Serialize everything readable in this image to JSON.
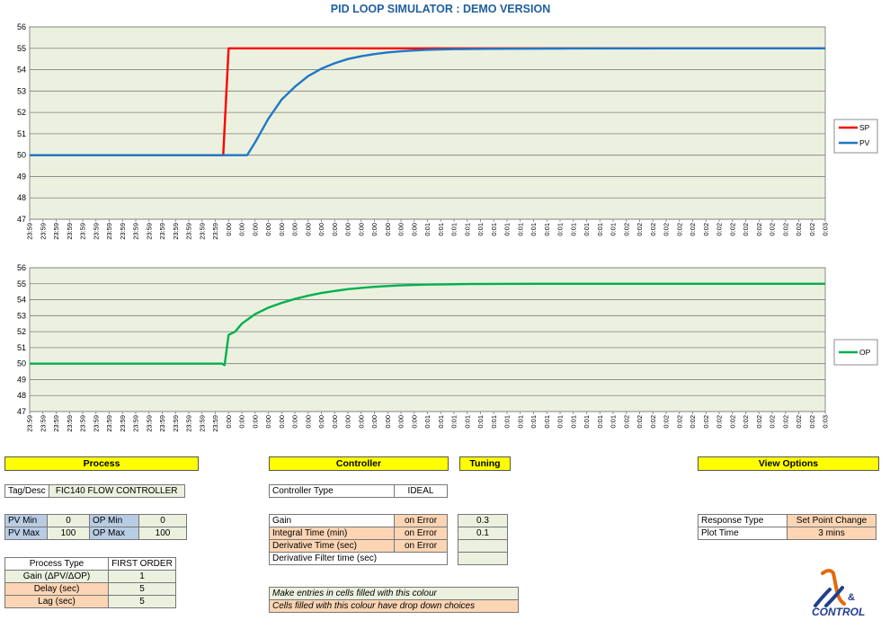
{
  "title": "PID LOOP SIMULATOR : DEMO VERSION",
  "chart_data": [
    {
      "type": "line",
      "ylim": [
        47,
        56
      ],
      "yticks": [
        47,
        48,
        49,
        50,
        51,
        52,
        53,
        54,
        55,
        56
      ],
      "x_labels": [
        "23:59",
        "23:59",
        "23:59",
        "23:59",
        "23:59",
        "23:59",
        "23:59",
        "23:59",
        "23:59",
        "23:59",
        "23:59",
        "23:59",
        "23:59",
        "23:59",
        "23:59",
        "0:00",
        "0:00",
        "0:00",
        "0:00",
        "0:00",
        "0:00",
        "0:00",
        "0:00",
        "0:00",
        "0:00",
        "0:00",
        "0:00",
        "0:00",
        "0:00",
        "0:00",
        "0:01",
        "0:01",
        "0:01",
        "0:01",
        "0:01",
        "0:01",
        "0:01",
        "0:01",
        "0:01",
        "0:01",
        "0:01",
        "0:01",
        "0:01",
        "0:01",
        "0:01",
        "0:02",
        "0:02",
        "0:02",
        "0:02",
        "0:02",
        "0:02",
        "0:02",
        "0:02",
        "0:02",
        "0:02",
        "0:02",
        "0:02",
        "0:02",
        "0:02",
        "0:02",
        "0:03"
      ],
      "legend": "right",
      "grid": true,
      "series": [
        {
          "name": "SP",
          "color": "#ff0000",
          "points": [
            [
              0,
              50
            ],
            [
              14.6,
              50
            ],
            [
              15,
              55
            ],
            [
              60,
              55
            ]
          ]
        },
        {
          "name": "PV",
          "color": "#1f77c8",
          "points": [
            [
              0,
              50
            ],
            [
              16.4,
              50
            ],
            [
              17,
              50.6
            ],
            [
              18,
              51.7
            ],
            [
              19,
              52.6
            ],
            [
              20,
              53.2
            ],
            [
              21,
              53.7
            ],
            [
              22,
              54.05
            ],
            [
              23,
              54.3
            ],
            [
              24,
              54.5
            ],
            [
              25,
              54.63
            ],
            [
              26,
              54.73
            ],
            [
              27,
              54.81
            ],
            [
              28,
              54.86
            ],
            [
              29,
              54.9
            ],
            [
              30,
              54.93
            ],
            [
              32,
              54.96
            ],
            [
              35,
              54.98
            ],
            [
              40,
              54.99
            ],
            [
              50,
              55
            ],
            [
              60,
              55
            ]
          ]
        }
      ]
    },
    {
      "type": "line",
      "ylim": [
        47,
        56
      ],
      "yticks": [
        47,
        48,
        49,
        50,
        51,
        52,
        53,
        54,
        55,
        56
      ],
      "x_labels": [
        "23:59",
        "23:59",
        "23:59",
        "23:59",
        "23:59",
        "23:59",
        "23:59",
        "23:59",
        "23:59",
        "23:59",
        "23:59",
        "23:59",
        "23:59",
        "23:59",
        "23:59",
        "0:00",
        "0:00",
        "0:00",
        "0:00",
        "0:00",
        "0:00",
        "0:00",
        "0:00",
        "0:00",
        "0:00",
        "0:00",
        "0:00",
        "0:00",
        "0:00",
        "0:00",
        "0:01",
        "0:01",
        "0:01",
        "0:01",
        "0:01",
        "0:01",
        "0:01",
        "0:01",
        "0:01",
        "0:01",
        "0:01",
        "0:01",
        "0:01",
        "0:01",
        "0:01",
        "0:02",
        "0:02",
        "0:02",
        "0:02",
        "0:02",
        "0:02",
        "0:02",
        "0:02",
        "0:02",
        "0:02",
        "0:02",
        "0:02",
        "0:02",
        "0:02",
        "0:02",
        "0:03"
      ],
      "legend": "right",
      "grid": true,
      "series": [
        {
          "name": "OP",
          "color": "#00b050",
          "points": [
            [
              0,
              50
            ],
            [
              14.5,
              50
            ],
            [
              14.7,
              49.9
            ],
            [
              15,
              51.8
            ],
            [
              15.5,
              52
            ],
            [
              16,
              52.5
            ],
            [
              17,
              53.1
            ],
            [
              18,
              53.5
            ],
            [
              19,
              53.8
            ],
            [
              20,
              54.05
            ],
            [
              21,
              54.25
            ],
            [
              22,
              54.42
            ],
            [
              23,
              54.55
            ],
            [
              24,
              54.66
            ],
            [
              25,
              54.74
            ],
            [
              26,
              54.81
            ],
            [
              27,
              54.86
            ],
            [
              28,
              54.9
            ],
            [
              30,
              54.95
            ],
            [
              33,
              54.98
            ],
            [
              38,
              55
            ],
            [
              60,
              55
            ]
          ]
        }
      ]
    }
  ],
  "panels": {
    "process_header": "Process",
    "controller_header": "Controller",
    "tuning_header": "Tuning",
    "view_header": "View Options",
    "tag_label": "Tag/Desc",
    "tag_value": "FIC140 FLOW CONTROLLER",
    "pv_min_label": "PV Min",
    "pv_min": "0",
    "op_min_label": "OP Min",
    "op_min": "0",
    "pv_max_label": "PV Max",
    "pv_max": "100",
    "op_max_label": "OP Max",
    "op_max": "100",
    "process_type_label": "Process Type",
    "process_type": "FIRST ORDER",
    "gain_label": "Gain (ΔPV/ΔOP)",
    "gain": "1",
    "delay_label": "Delay (sec)",
    "delay": "5",
    "lag_label": "Lag (sec)",
    "lag": "5",
    "controller_type_label": "Controller Type",
    "controller_type": "IDEAL",
    "ctrl_gain_label": "Gain",
    "ctrl_gain_err": "on Error",
    "ctrl_gain_val": "0.3",
    "integral_label": "Integral Time (min)",
    "integral_err": "on Error",
    "integral_val": "0.1",
    "derivative_label": "Derivative Time (sec)",
    "derivative_err": "on Error",
    "derivative_val": "",
    "deriv_filter_label": "Derivative Filter time (sec)",
    "deriv_filter_val": "",
    "note_green": "Make entries in cells filled with this colour",
    "note_orange": "Cells filled with this colour have drop down choices",
    "response_type_label": "Response Type",
    "response_type": "Set Point Change",
    "plot_time_label": "Plot Time",
    "plot_time": "3 mins",
    "logo_text": "CONTROL",
    "logo_amp": "&"
  }
}
